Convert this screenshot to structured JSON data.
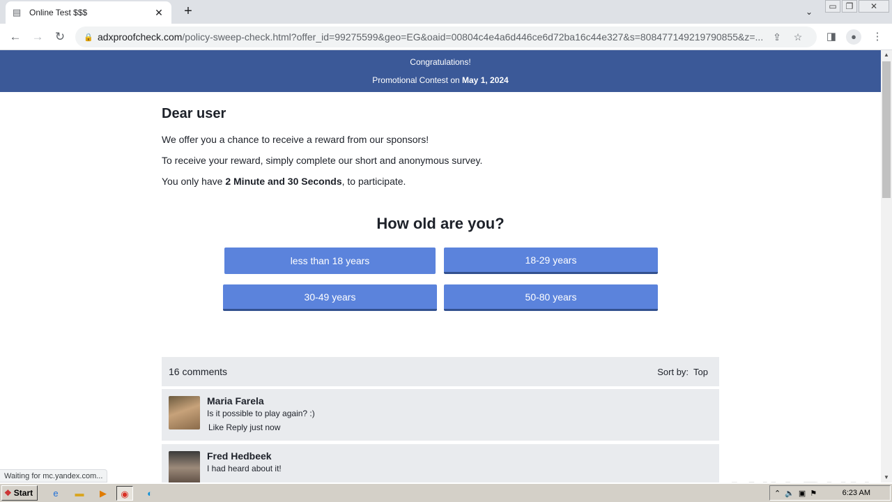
{
  "browser": {
    "tab_title": "Online Test $$$",
    "tab_close": "✕",
    "new_tab": "+",
    "url_domain": "adxproofcheck.com",
    "url_rest": "/policy-sweep-check.html?offer_id=99275599&geo=EG&oaid=00804c4e4a6d446ce6d72ba16c44e327&s=808477149219790855&z=...",
    "status_text": "Waiting for mc.yandex.com..."
  },
  "banner": {
    "line1": "Congratulations!",
    "line2_prefix": "Promotional Contest on ",
    "line2_date": "May 1, 2024"
  },
  "intro": {
    "heading": "Dear user",
    "p1": "We offer you a chance to receive a reward from our sponsors!",
    "p2": "To receive your reward, simply complete our short and anonymous survey.",
    "p3_prefix": "You only have ",
    "p3_bold": "2 Minute and 30 Seconds",
    "p3_suffix": ", to participate."
  },
  "survey": {
    "question": "How old are you?",
    "options": [
      "less than 18 years",
      "18-29 years",
      "30-49 years",
      "50-80 years"
    ]
  },
  "comments": {
    "count_label": "16 comments",
    "sort_label": "Sort by:",
    "sort_value": "Top",
    "items": [
      {
        "name": "Maria Farela",
        "text": "Is it possible to play again? :)",
        "meta": "Like Reply  just now"
      },
      {
        "name": "Fred Hedbeek",
        "text": "I had heard about it!"
      }
    ]
  },
  "watermark": "ANY RUN",
  "taskbar": {
    "start_label": "Start",
    "clock": "6:23 AM"
  },
  "colors": {
    "banner": "#3b5998",
    "button": "#5b83dc",
    "comment_bg": "#e9ebee"
  }
}
